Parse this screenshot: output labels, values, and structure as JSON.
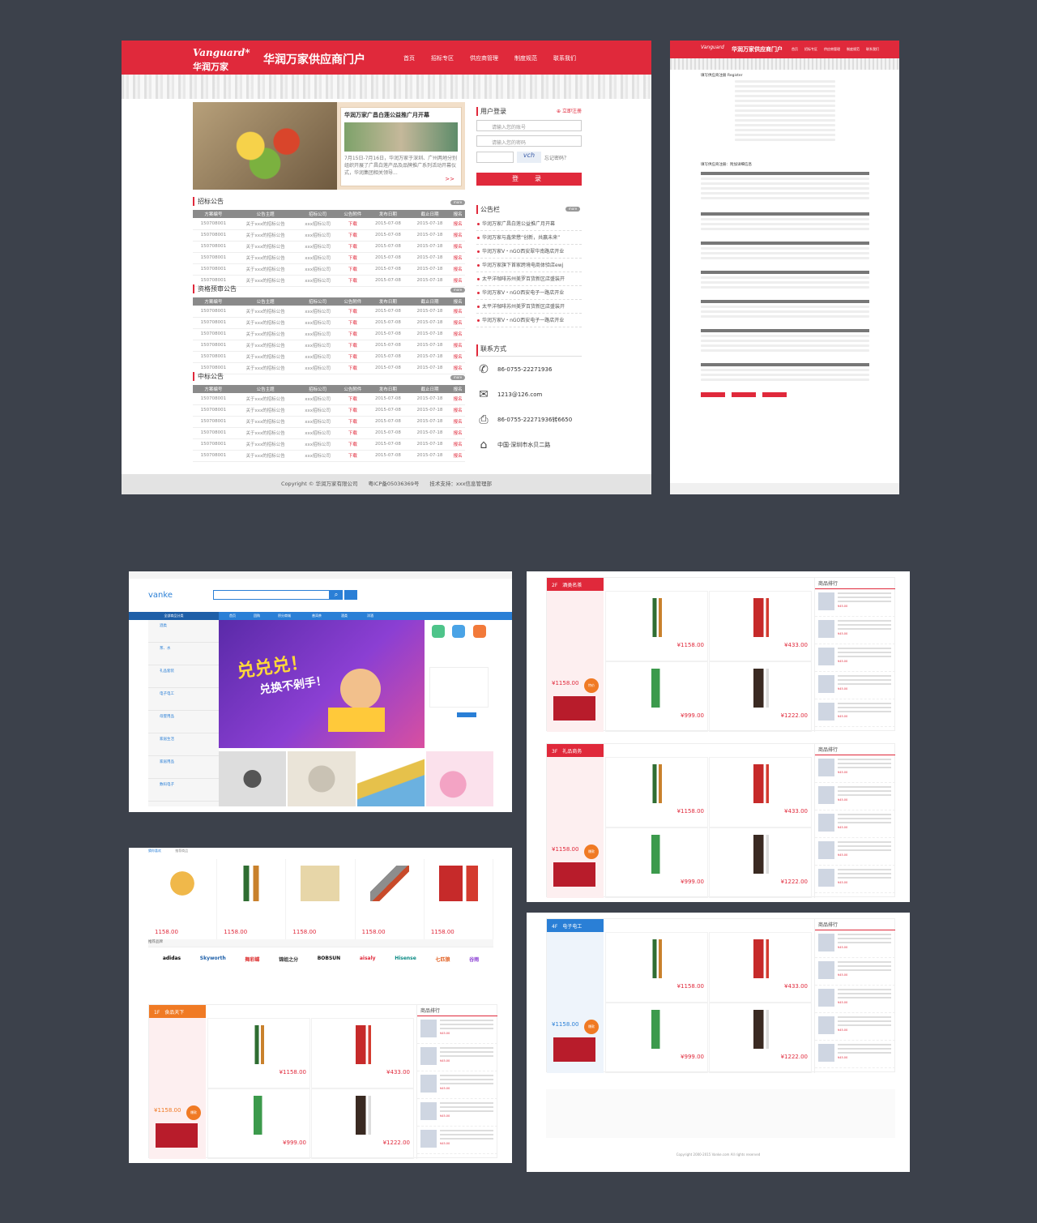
{
  "c1": {
    "logo": "Vanguard",
    "logo_star": "*",
    "logo_cn": "华润万家",
    "title": "华润万家供应商门户",
    "nav": [
      "首页",
      "招标专区",
      "供应商管理",
      "制度规范",
      "联系我们"
    ],
    "banner": {
      "card_title": "华润万家广昌白莲公益推广月开幕",
      "card_text": "7月15日-7月16日，华润万家于深圳、广州两地分别组织开展了广昌白莲产品及品牌推广系列活动开幕仪式，华润集团相关领导...",
      "more": ">>"
    },
    "columns": [
      "方案编号",
      "公告主题",
      "招标公司",
      "公告附件",
      "发布日期",
      "截止日期",
      "报名"
    ],
    "row": {
      "id": "150708001",
      "topic": "关于xxx的招标公告",
      "company": "xxx招标公司",
      "attach": "下载",
      "publish": "2015-07-08",
      "deadline": "2015-07-18",
      "signup": "报名"
    },
    "sections": [
      "招标公告",
      "资格预审公告",
      "中标公告"
    ],
    "more": "more",
    "login": {
      "title": "用户登录",
      "register": "立即注册",
      "account_placeholder": "请输入您的账号",
      "password_placeholder": "请输入您的密码",
      "captcha": "vch",
      "forgot": "忘记密码？",
      "button": "登　录"
    },
    "notice": {
      "title": "公告栏",
      "items": [
        "华润万家广昌白莲公益推广月开幕",
        "华润万家与鑫荣懋“创新，共赢未来”",
        "华润万家V・nGO西安翠华南路店开业",
        "华润万家旗下首家跨境电商体验店ewj",
        "太平洋咖啡苏州美罗百货新区店盛装开",
        "华润万家V・nGO西安电子一路店开业",
        "太平洋咖啡苏州美罗百货新区店盛装开",
        "华润万家V・nGO西安电子一路店开业"
      ]
    },
    "contact": {
      "title": "联系方式",
      "phone": "86-0755-22271936",
      "email": "1213@126.com",
      "fax": "86-0755-22271936转6650",
      "address": "中国·深圳市水贝二路"
    },
    "footer": "Copyright © 华润万家有限公司　　粤ICP备05036369号　　技术支持：xxx信息管理部"
  },
  "c2": {
    "logo": "Vanguard",
    "title": "华润万家供应商门户",
    "nav": [
      "首页",
      "招标专区",
      "供应商管理",
      "制度规范",
      "联系我们"
    ],
    "section1": "填写供应商注册 Register",
    "section2": "填写供应商注册：附加详细信息",
    "button": "立即注册"
  },
  "c3": {
    "logo": "vanke",
    "nav": [
      "全部商品分类",
      "首页",
      "团购",
      "积分商城",
      "普洱茶",
      "酒类",
      "洋酒"
    ],
    "categories": [
      "酒类",
      "茶、水",
      "礼品套装",
      "电子电工",
      "母婴用品",
      "家居生活",
      "家居用品",
      "数码电子"
    ],
    "promo_line1": "兑兑兑！",
    "promo_line2": "兑换不剁手！"
  },
  "c4": {
    "floors": [
      {
        "tag": "2F",
        "name": "酒类名茶",
        "rank": "商品排行",
        "prices": [
          "1158.00",
          "433.00",
          "999.00",
          "1222.00"
        ],
        "side_price": "1158.00",
        "badge": "特价"
      },
      {
        "tag": "3F",
        "name": "礼品商务",
        "rank": "商品排行",
        "prices": [
          "1158.00",
          "433.00",
          "999.00",
          "1222.00"
        ],
        "side_price": "1158.00",
        "badge": "爆款"
      }
    ]
  },
  "c5": {
    "tabs": [
      "猜你喜欢",
      "推荐商品"
    ],
    "hot_prices": [
      "1158.00",
      "1158.00",
      "1158.00",
      "1158.00",
      "1158.00"
    ],
    "brands_title": "推荐品牌",
    "brands": [
      "adidas",
      "Skyworth",
      "舞彩蝶",
      "锦姐之分",
      "BOBSUN",
      "aisaly",
      "Hisense",
      "七匹狼",
      "谷雨"
    ],
    "floor": {
      "tag": "1F",
      "name": "食品天下",
      "rank": "商品排行",
      "prices": [
        "1158.00",
        "433.00",
        "999.00",
        "1222.00"
      ],
      "side_price": "1158.00",
      "badge": "爆款"
    }
  },
  "c6": {
    "floor": {
      "tag": "4F",
      "name": "电子电工",
      "rank": "商品排行",
      "prices": [
        "1158.00",
        "433.00",
        "999.00",
        "1222.00"
      ],
      "side_price": "1158.00",
      "badge": "爆款"
    },
    "copyright": "Copyright 2000-2015 Vanke.com All rights reserved"
  }
}
